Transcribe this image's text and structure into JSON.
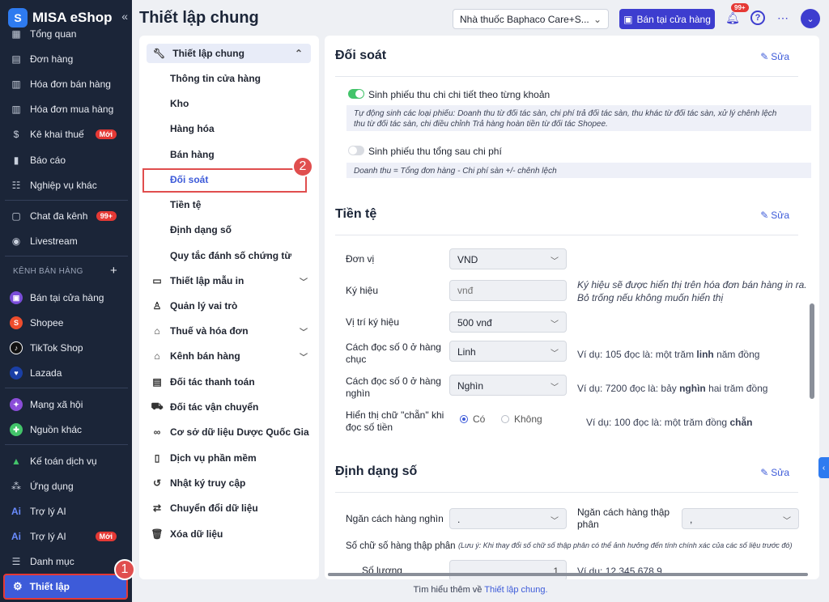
{
  "sidebar": {
    "brand": "MISA eShop",
    "collapse_icon": "«",
    "items": [
      {
        "label": "Tổng quan",
        "icon": "chart-icon"
      },
      {
        "label": "Đơn hàng",
        "icon": "clipboard-icon"
      },
      {
        "label": "Hóa đơn bán hàng",
        "icon": "receipt-icon"
      },
      {
        "label": "Hóa đơn mua hàng",
        "icon": "receipt-icon"
      },
      {
        "label": "Kê khai thuế",
        "icon": "tax-icon",
        "badge": "Mới"
      },
      {
        "label": "Báo cáo",
        "icon": "bar-chart-icon"
      },
      {
        "label": "Nghiệp vụ khác",
        "icon": "list-icon"
      },
      {
        "label": "Chat đa kênh",
        "icon": "chat-icon",
        "badge": "99+"
      },
      {
        "label": "Livestream",
        "icon": "broadcast-icon"
      }
    ],
    "section_title": "KÊNH BÁN HÀNG",
    "channels": [
      {
        "label": "Bán tại cửa hàng",
        "color": "#7a4dd8"
      },
      {
        "label": "Shopee",
        "color": "#ee4d2d"
      },
      {
        "label": "TikTok Shop",
        "color": "#111111"
      },
      {
        "label": "Lazada",
        "color": "#1a3fa6"
      }
    ],
    "items2": [
      {
        "label": "Mạng xã hội",
        "color": "#8a4dd8"
      },
      {
        "label": "Nguồn khác",
        "color": "#43c46a"
      }
    ],
    "items3": [
      {
        "label": "Kế toán dịch vụ"
      },
      {
        "label": "Ứng dụng"
      },
      {
        "label": "Trợ lý AI"
      },
      {
        "label": "Trợ lý AI",
        "badge": "Mới"
      },
      {
        "label": "Danh mục"
      }
    ],
    "active_item": "Thiết lập"
  },
  "callouts": {
    "one": "1",
    "two": "2"
  },
  "header": {
    "title": "Thiết lập chung",
    "store": "Nhà thuốc Baphaco Care+S...",
    "sell_button": "Bán tại cửa hàng",
    "notif_badge": "99+"
  },
  "menu": {
    "head": "Thiết lập chung",
    "subitems": [
      "Thông tin cửa hàng",
      "Kho",
      "Hàng hóa",
      "Bán hàng",
      "Đối soát",
      "Tiền tệ",
      "Định dạng số",
      "Quy tắc đánh số chứng từ"
    ],
    "items": [
      {
        "label": "Thiết lập mẫu in",
        "chev": true
      },
      {
        "label": "Quản lý vai trò",
        "chev": false
      },
      {
        "label": "Thuế và hóa đơn",
        "chev": true
      },
      {
        "label": "Kênh bán hàng",
        "chev": true
      },
      {
        "label": "Đối tác thanh toán",
        "chev": false
      },
      {
        "label": "Đối tác vận chuyển",
        "chev": false
      },
      {
        "label": "Cơ sở dữ liệu Dược Quốc Gia",
        "chev": false
      },
      {
        "label": "Dịch vụ phần mềm",
        "chev": false
      },
      {
        "label": "Nhật ký truy cập",
        "chev": false
      },
      {
        "label": "Chuyển đổi dữ liệu",
        "chev": false
      },
      {
        "label": "Xóa dữ liệu",
        "chev": false
      }
    ]
  },
  "content": {
    "edit_label": "Sửa",
    "doisoat": {
      "title": "Đối soát",
      "opt1": {
        "label": "Sinh phiếu thu chi chi tiết theo từng khoản",
        "on": true,
        "note1": "Tự động sinh các loại phiếu: Doanh thu từ đối tác sàn, chi phí trả đối tác sàn, thu khác từ đối tác sàn, xử lý chênh lệch",
        "note2": "thu từ đối tác sàn, chi điều chỉnh Trả hàng hoàn tiền từ đối tác Shopee."
      },
      "opt2": {
        "label": "Sinh phiếu thu tổng sau chi phí",
        "on": false,
        "note": "Doanh thu = Tổng đơn hàng - Chi phí sàn +/- chênh lệch"
      }
    },
    "tiente": {
      "title": "Tiền tệ",
      "don_vi": {
        "label": "Đơn vị",
        "value": "VND"
      },
      "ky_hieu": {
        "label": "Ký hiệu",
        "placeholder": "vnđ",
        "hint1": "Ký hiệu sẽ được hiển thị trên hóa đơn bán hàng in ra.",
        "hint2": "Bỏ trống nếu không muốn hiển thị"
      },
      "vi_tri": {
        "label": "Vị trí ký hiệu",
        "value": "500 vnđ"
      },
      "doc_chuc": {
        "label1": "Cách đọc số 0 ở hàng",
        "label2": "chục",
        "value": "Linh",
        "ex_pre": "Ví dụ: 105 đọc là: một trăm ",
        "ex_bold": "linh",
        "ex_post": " năm đồng"
      },
      "doc_nghin": {
        "label1": "Cách đọc số 0 ở hàng",
        "label2": "nghìn",
        "value": "Nghìn",
        "ex_pre": "Ví dụ: 7200 đọc là: bảy ",
        "ex_bold": "nghìn",
        "ex_post": " hai trăm đồng"
      },
      "chan": {
        "label1": "Hiển thị chữ \"chẵn\" khi",
        "label2": "đọc số tiền",
        "opt_yes": "Có",
        "opt_no": "Không",
        "ex_pre": "Ví dụ: 100 đọc là: một trăm đồng ",
        "ex_bold": "chẵn"
      }
    },
    "dinhdang": {
      "title": "Định dạng số",
      "ngan_nghin": {
        "label": "Ngăn cách hàng nghìn",
        "value": "."
      },
      "ngan_tp": {
        "label1": "Ngăn cách hàng thập",
        "label2": "phân",
        "value": ","
      },
      "so_tp": {
        "label": "Số chữ số hàng thập phân",
        "note": "(Lưu ý: Khi thay đổi số chữ số thập phân có thể ảnh hưởng đến tính chính xác của các số liệu trước đó)"
      },
      "so_luong": {
        "label": "Số lượng",
        "value": "1",
        "example": "Ví dụ: 12.345.678,9"
      }
    }
  },
  "footer": {
    "text": "Tìm hiểu thêm về ",
    "link": "Thiết lập chung."
  }
}
